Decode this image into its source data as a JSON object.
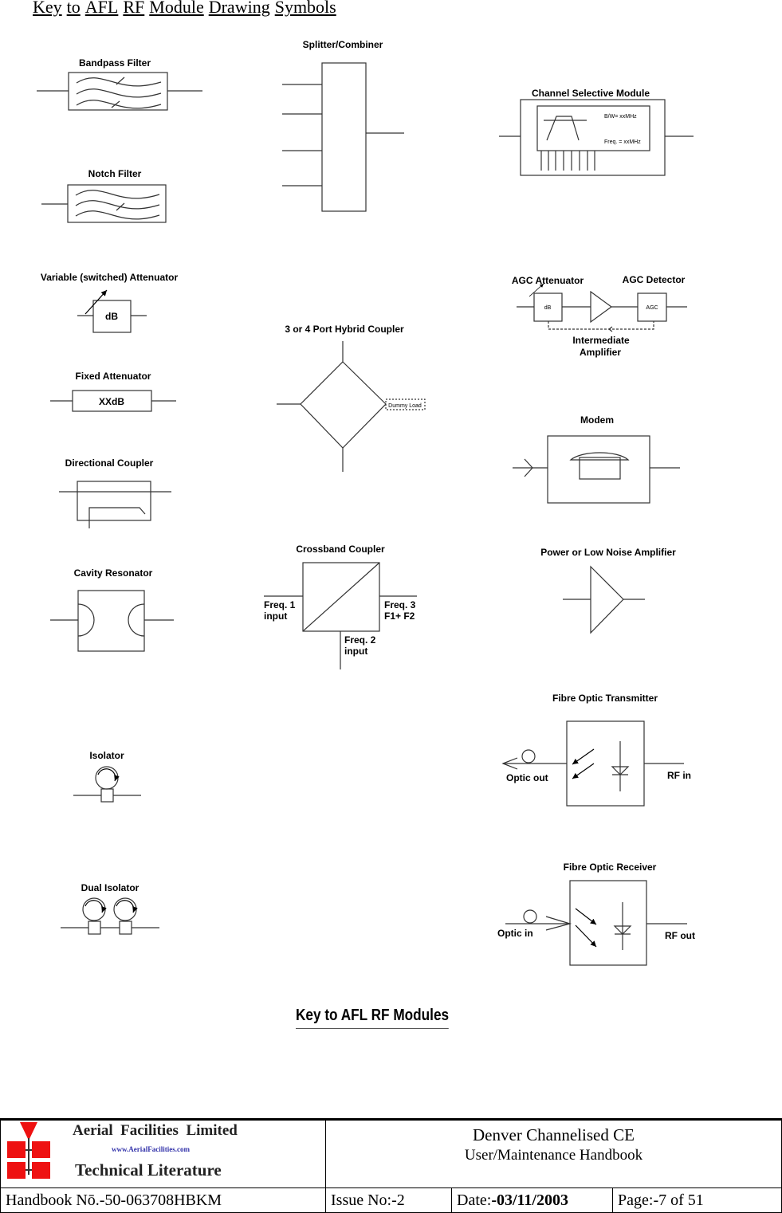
{
  "page_title_words": [
    "Key",
    "to",
    "AFL",
    "RF",
    "Module",
    "Drawing",
    "Symbols"
  ],
  "symbols": {
    "bandpass_filter": "Bandpass Filter",
    "notch_filter": "Notch Filter",
    "splitter_combiner": "Splitter/Combiner",
    "channel_selective_module": {
      "title": "Channel Selective Module",
      "bw": "B/W= xxMHz",
      "freq": "Freq. = xxMHz"
    },
    "variable_attenuator": {
      "title": "Variable (switched) Attenuator",
      "value": "dB"
    },
    "fixed_attenuator": {
      "title": "Fixed Attenuator",
      "value": "XXdB"
    },
    "directional_coupler": "Directional Coupler",
    "cavity_resonator": "Cavity Resonator",
    "hybrid_coupler": {
      "title": "3 or 4 Port Hybrid Coupler",
      "dummy_load": "Dummy Load"
    },
    "agc": {
      "attenuator_title": "AGC Attenuator",
      "detector_title": "AGC Detector",
      "attenuator_value": "dB",
      "detector_value": "AGC",
      "amplifier_line1": "Intermediate",
      "amplifier_line2": "Amplifier"
    },
    "modem": "Modem",
    "amplifier": "Power or Low Noise Amplifier",
    "crossband_coupler": {
      "title": "Crossband Coupler",
      "freq1_line1": "Freq. 1",
      "freq1_line2": "input",
      "freq2_line1": "Freq. 2",
      "freq2_line2": "input",
      "freq3_line1": "Freq. 3",
      "freq3_line2": "F1+ F2"
    },
    "isolator": "Isolator",
    "dual_isolator": "Dual Isolator",
    "fibre_tx": {
      "title": "Fibre Optic Transmitter",
      "optic": "Optic out",
      "rf": "RF in"
    },
    "fibre_rx": {
      "title": "Fibre Optic Receiver",
      "optic": "Optic in",
      "rf": "RF out"
    }
  },
  "caption": "Key to AFL RF Modules",
  "footer": {
    "company": "Aerial  Facilities  Limited",
    "website": "www.AerialFacilities.com",
    "literature": "Technical Literature",
    "doc_title": "Denver Channelised CE",
    "doc_subtitle": "User/Maintenance Handbook",
    "handbook_no": "Handbook Nō.-50-063708HBKM",
    "issue": "Issue No:-2",
    "date_label": "Date:",
    "date_value": "-03/11/2003",
    "page_label": "Page:",
    "page_value": "-7 of 51",
    "logo_color": "#ee1111"
  }
}
